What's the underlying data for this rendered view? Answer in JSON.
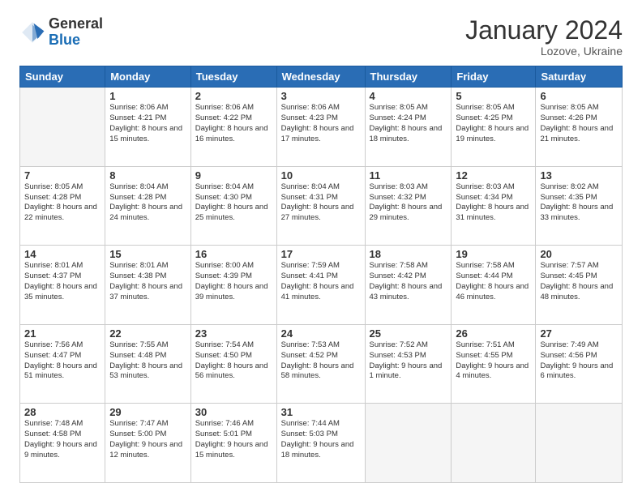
{
  "header": {
    "logo_text_general": "General",
    "logo_text_blue": "Blue",
    "title": "January 2024",
    "subtitle": "Lozove, Ukraine"
  },
  "weekdays": [
    "Sunday",
    "Monday",
    "Tuesday",
    "Wednesday",
    "Thursday",
    "Friday",
    "Saturday"
  ],
  "weeks": [
    [
      {
        "day": "",
        "info": ""
      },
      {
        "day": "1",
        "info": "Sunrise: 8:06 AM\nSunset: 4:21 PM\nDaylight: 8 hours\nand 15 minutes."
      },
      {
        "day": "2",
        "info": "Sunrise: 8:06 AM\nSunset: 4:22 PM\nDaylight: 8 hours\nand 16 minutes."
      },
      {
        "day": "3",
        "info": "Sunrise: 8:06 AM\nSunset: 4:23 PM\nDaylight: 8 hours\nand 17 minutes."
      },
      {
        "day": "4",
        "info": "Sunrise: 8:05 AM\nSunset: 4:24 PM\nDaylight: 8 hours\nand 18 minutes."
      },
      {
        "day": "5",
        "info": "Sunrise: 8:05 AM\nSunset: 4:25 PM\nDaylight: 8 hours\nand 19 minutes."
      },
      {
        "day": "6",
        "info": "Sunrise: 8:05 AM\nSunset: 4:26 PM\nDaylight: 8 hours\nand 21 minutes."
      }
    ],
    [
      {
        "day": "7",
        "info": ""
      },
      {
        "day": "8",
        "info": "Sunrise: 8:04 AM\nSunset: 4:28 PM\nDaylight: 8 hours\nand 24 minutes."
      },
      {
        "day": "9",
        "info": "Sunrise: 8:04 AM\nSunset: 4:30 PM\nDaylight: 8 hours\nand 25 minutes."
      },
      {
        "day": "10",
        "info": "Sunrise: 8:04 AM\nSunset: 4:31 PM\nDaylight: 8 hours\nand 27 minutes."
      },
      {
        "day": "11",
        "info": "Sunrise: 8:03 AM\nSunset: 4:32 PM\nDaylight: 8 hours\nand 29 minutes."
      },
      {
        "day": "12",
        "info": "Sunrise: 8:03 AM\nSunset: 4:34 PM\nDaylight: 8 hours\nand 31 minutes."
      },
      {
        "day": "13",
        "info": "Sunrise: 8:02 AM\nSunset: 4:35 PM\nDaylight: 8 hours\nand 33 minutes."
      }
    ],
    [
      {
        "day": "14",
        "info": ""
      },
      {
        "day": "15",
        "info": "Sunrise: 8:01 AM\nSunset: 4:38 PM\nDaylight: 8 hours\nand 37 minutes."
      },
      {
        "day": "16",
        "info": "Sunrise: 8:00 AM\nSunset: 4:39 PM\nDaylight: 8 hours\nand 39 minutes."
      },
      {
        "day": "17",
        "info": "Sunrise: 7:59 AM\nSunset: 4:41 PM\nDaylight: 8 hours\nand 41 minutes."
      },
      {
        "day": "18",
        "info": "Sunrise: 7:58 AM\nSunset: 4:42 PM\nDaylight: 8 hours\nand 43 minutes."
      },
      {
        "day": "19",
        "info": "Sunrise: 7:58 AM\nSunset: 4:44 PM\nDaylight: 8 hours\nand 46 minutes."
      },
      {
        "day": "20",
        "info": "Sunrise: 7:57 AM\nSunset: 4:45 PM\nDaylight: 8 hours\nand 48 minutes."
      }
    ],
    [
      {
        "day": "21",
        "info": ""
      },
      {
        "day": "22",
        "info": "Sunrise: 7:55 AM\nSunset: 4:48 PM\nDaylight: 8 hours\nand 53 minutes."
      },
      {
        "day": "23",
        "info": "Sunrise: 7:54 AM\nSunset: 4:50 PM\nDaylight: 8 hours\nand 56 minutes."
      },
      {
        "day": "24",
        "info": "Sunrise: 7:53 AM\nSunset: 4:52 PM\nDaylight: 8 hours\nand 58 minutes."
      },
      {
        "day": "25",
        "info": "Sunrise: 7:52 AM\nSunset: 4:53 PM\nDaylight: 9 hours\nand 1 minute."
      },
      {
        "day": "26",
        "info": "Sunrise: 7:51 AM\nSunset: 4:55 PM\nDaylight: 9 hours\nand 4 minutes."
      },
      {
        "day": "27",
        "info": "Sunrise: 7:49 AM\nSunset: 4:56 PM\nDaylight: 9 hours\nand 6 minutes."
      }
    ],
    [
      {
        "day": "28",
        "info": ""
      },
      {
        "day": "29",
        "info": "Sunrise: 7:47 AM\nSunset: 5:00 PM\nDaylight: 9 hours\nand 12 minutes."
      },
      {
        "day": "30",
        "info": "Sunrise: 7:46 AM\nSunset: 5:01 PM\nDaylight: 9 hours\nand 15 minutes."
      },
      {
        "day": "31",
        "info": "Sunrise: 7:44 AM\nSunset: 5:03 PM\nDaylight: 9 hours\nand 18 minutes."
      },
      {
        "day": "",
        "info": ""
      },
      {
        "day": "",
        "info": ""
      },
      {
        "day": "",
        "info": ""
      }
    ]
  ],
  "week0_day7_info": "Sunrise: 8:05 AM\nSunset: 4:28 PM\nDaylight: 8 hours\nand 22 minutes.",
  "week1_day0_info": "Sunrise: 8:05 AM\nSunset: 4:28 PM\nDaylight: 8 hours\nand 22 minutes.",
  "week2_day0_info": "Sunrise: 8:01 AM\nSunset: 4:37 PM\nDaylight: 8 hours\nand 35 minutes.",
  "week3_day0_info": "Sunrise: 7:56 AM\nSunset: 4:47 PM\nDaylight: 8 hours\nand 51 minutes.",
  "week4_day0_info": "Sunrise: 7:48 AM\nSunset: 4:58 PM\nDaylight: 9 hours\nand 9 minutes."
}
